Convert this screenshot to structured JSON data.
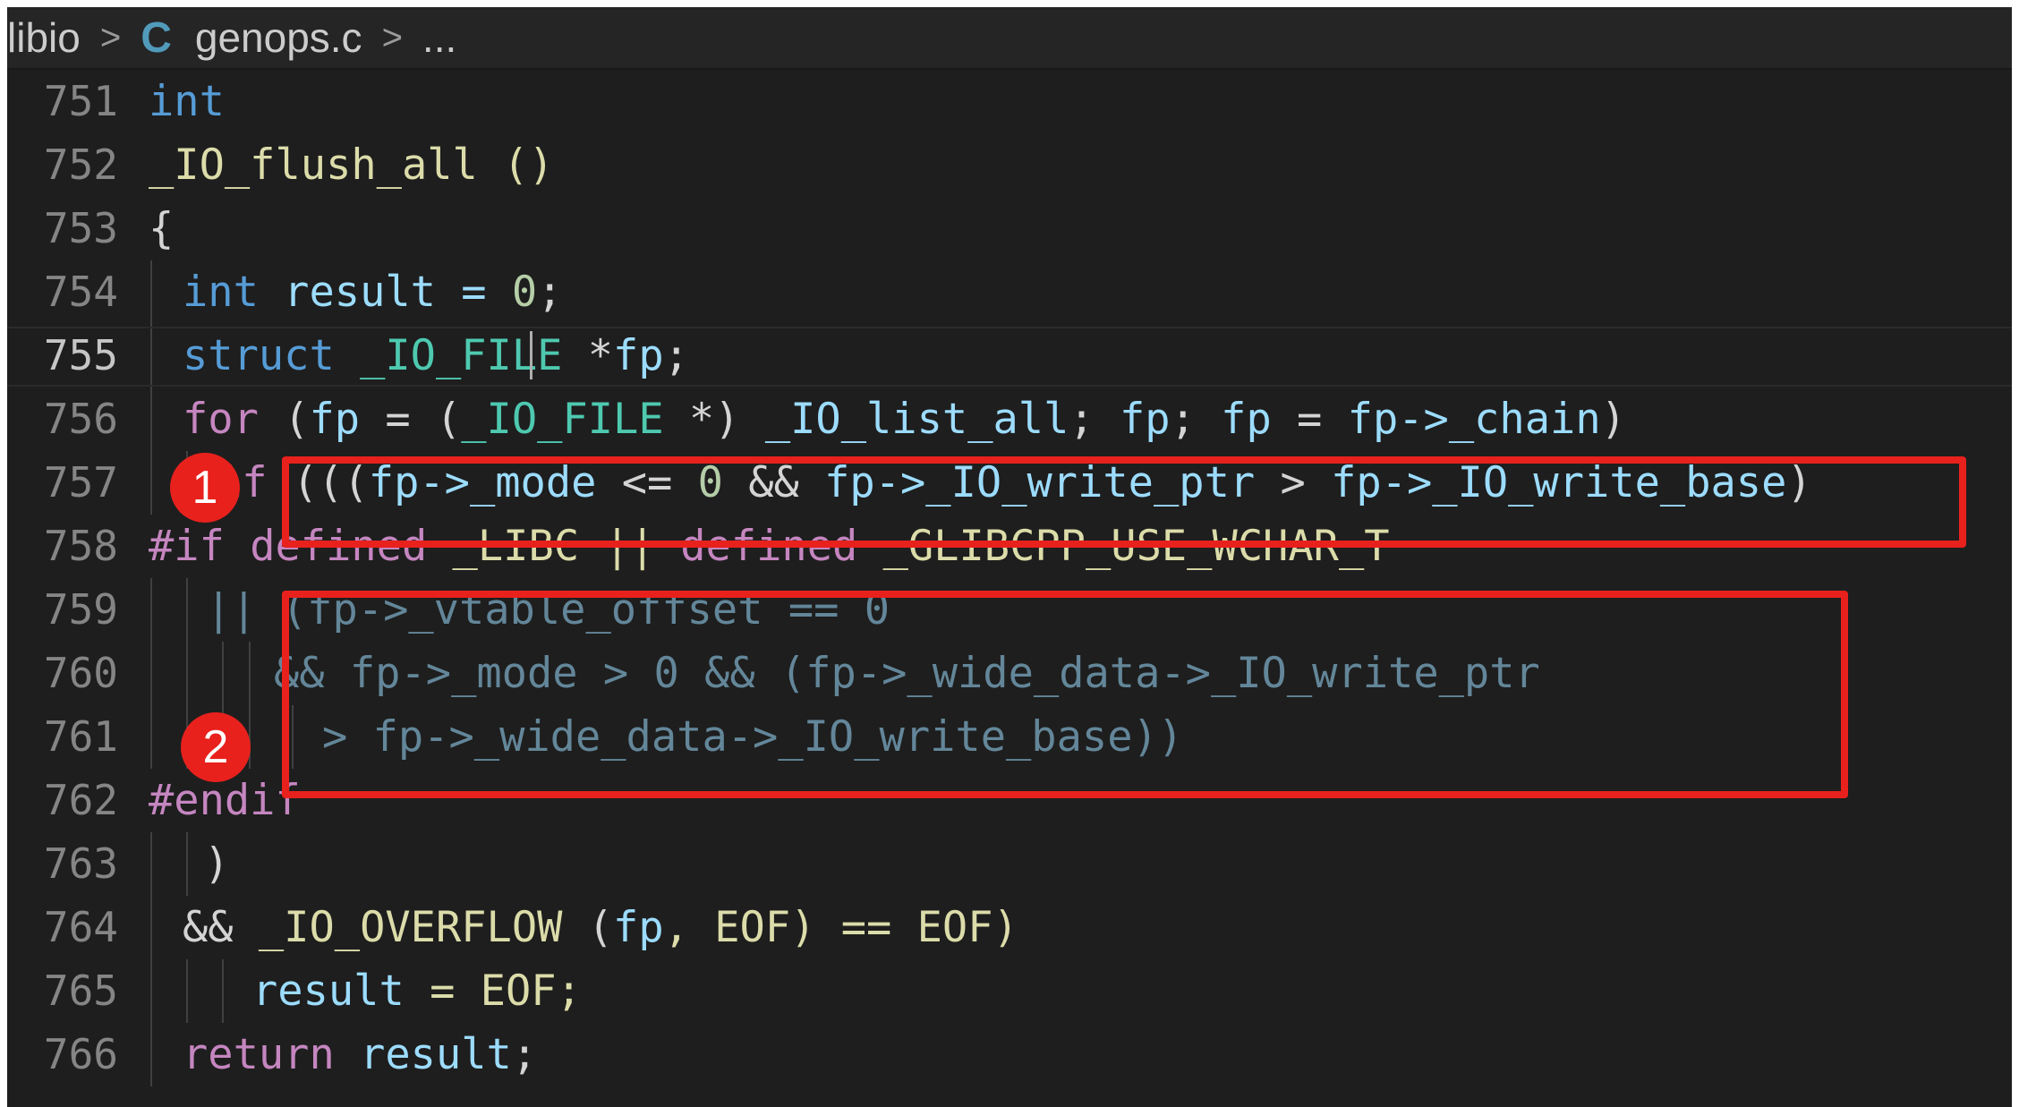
{
  "breadcrumb": {
    "folder": "libio",
    "file_icon": "C",
    "file": "genops.c",
    "more": "...",
    "separator": ">"
  },
  "editor": {
    "current_line": 755,
    "lines": [
      {
        "number": "751",
        "tokens": [
          "int"
        ]
      },
      {
        "number": "752",
        "tokens": [
          "_IO_flush_all ()"
        ]
      },
      {
        "number": "753",
        "tokens": [
          "{"
        ]
      },
      {
        "number": "754",
        "tokens": [
          "int",
          " result = ",
          "0",
          ";"
        ]
      },
      {
        "number": "755",
        "tokens": [
          "struct",
          " ",
          "_IO_FILE",
          " *",
          "fp",
          ";"
        ]
      },
      {
        "number": "756",
        "tokens": [
          "for",
          " (",
          "fp",
          " = (",
          "_IO_FILE",
          " *) ",
          "_IO_list_all",
          "; ",
          "fp",
          "; ",
          "fp",
          " = ",
          "fp->_chain",
          ")"
        ]
      },
      {
        "number": "757",
        "tokens": [
          "if",
          " (((",
          "fp->_mode",
          " <= ",
          "0",
          " && ",
          "fp->_IO_write_ptr",
          " > ",
          "fp->_IO_write_base",
          ")"
        ]
      },
      {
        "number": "758",
        "tokens": [
          "#if",
          " ",
          "defined",
          " _LIBC || ",
          "defined",
          " _GLIBCPP_USE_WCHAR_T"
        ]
      },
      {
        "number": "759",
        "tokens": [
          "|| (fp->_vtable_offset == 0"
        ]
      },
      {
        "number": "760",
        "tokens": [
          "&& fp->_mode > 0 && (fp->_wide_data->_IO_write_ptr"
        ]
      },
      {
        "number": "761",
        "tokens": [
          "> fp->_wide_data->_IO_write_base))"
        ]
      },
      {
        "number": "762",
        "tokens": [
          "#endif"
        ]
      },
      {
        "number": "763",
        "tokens": [
          ")"
        ]
      },
      {
        "number": "764",
        "tokens": [
          "&& ",
          "_IO_OVERFLOW",
          " (",
          "fp",
          ", EOF) == EOF)"
        ]
      },
      {
        "number": "765",
        "tokens": [
          "result",
          " = EOF;"
        ]
      },
      {
        "number": "766",
        "tokens": [
          "return",
          " ",
          "result",
          ";"
        ]
      }
    ]
  },
  "annotations": [
    {
      "label": "1"
    },
    {
      "label": "2"
    }
  ],
  "colors": {
    "annotation": "#e8211d",
    "background": "#1e1e1e",
    "keyword": "#569cd6",
    "control": "#c586c0",
    "variable": "#9cdcfe",
    "type": "#4ec9b0",
    "number": "#b5cea8"
  }
}
